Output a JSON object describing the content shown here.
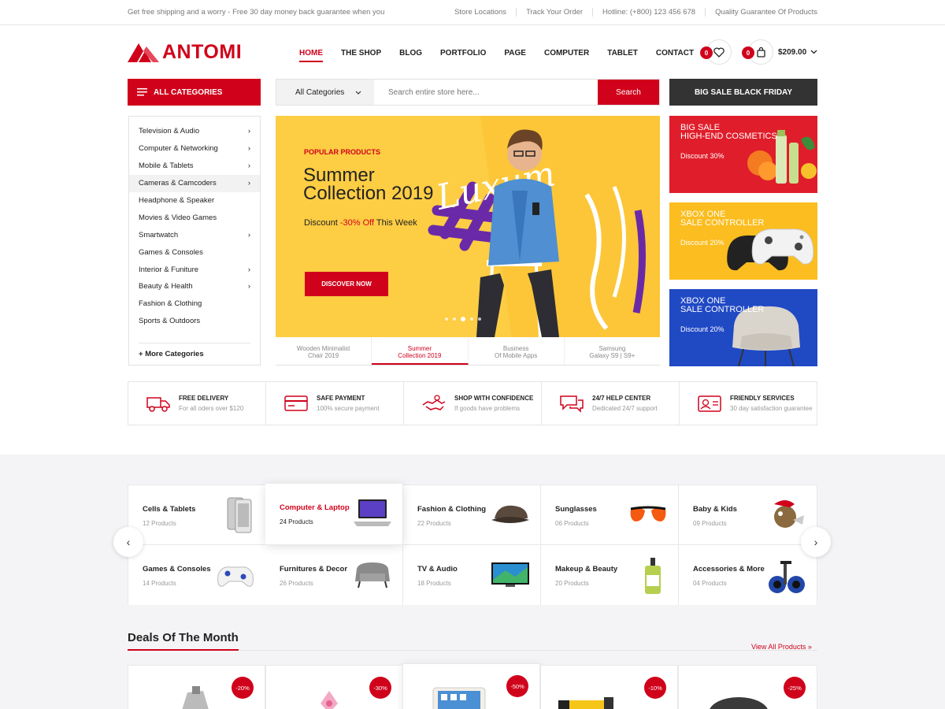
{
  "topbar": {
    "message": "Get free shipping and a worry - Free 30 day money back guarantee when you",
    "links": [
      "Store Locations",
      "Track Your Order",
      "Hotline: (+800) 123 456 678",
      "Quality Guarantee Of Products"
    ]
  },
  "brand": {
    "name": "ANTOMI",
    "color": "#d0021b"
  },
  "nav": {
    "items": [
      "HOME",
      "THE SHOP",
      "BLOG",
      "PORTFOLIO",
      "PAGE",
      "COMPUTER",
      "TABLET",
      "CONTACT"
    ],
    "active": "HOME"
  },
  "header": {
    "wishlist_count": "0",
    "cart_count": "0",
    "cart_total": "$209.00"
  },
  "categories_button": "ALL CATEGORIES",
  "search": {
    "category": "All Categories",
    "placeholder": "Search entire store here...",
    "button": "Search"
  },
  "big_sale": "BIG SALE BLACK FRIDAY",
  "category_list": [
    "Television & Audio",
    "Computer & Networking",
    "Mobile & Tablets",
    "Cameras & Camcoders",
    "Headphone & Speaker",
    "Movies & Video Games",
    "Smartwatch",
    "Games & Consoles",
    "Interior & Funiture",
    "Beauty & Health",
    "Fashion & Clothing",
    "Sports & Outdoors"
  ],
  "more_categories": "More Categories",
  "hero": {
    "eyebrow": "POPULAR PRODUCTS",
    "title_line1": "Summer",
    "title_line2": "Collection 2019",
    "discount_prefix": "Discount ",
    "discount_value": "-30% Off",
    "discount_suffix": " This Week",
    "button": "DISCOVER NOW",
    "script_text": "Luxum"
  },
  "slider_tabs": [
    {
      "line1": "Wooden Minimalist",
      "line2": "Chair 2019"
    },
    {
      "line1": "Summer",
      "line2": "Collection 2019"
    },
    {
      "line1": "Business",
      "line2": "Of Mobile Apps"
    },
    {
      "line1": "Samsung",
      "line2": "Galaxy S9 | S9+"
    }
  ],
  "promos": [
    {
      "line1": "BIG SALE",
      "line2": "HIGH-END COSMETICS",
      "discount": "Discount 30%",
      "color": "#e01e2b"
    },
    {
      "line1": "XBOX ONE",
      "line2": "SALE CONTROLLER",
      "discount": "Discount 20%",
      "color": "#fbbd1f"
    },
    {
      "line1": "XBOX ONE",
      "line2": "SALE CONTROLLER",
      "discount": "Discount 20%",
      "color": "#2049c4"
    }
  ],
  "features": [
    {
      "title": "FREE DELIVERY",
      "sub": "For all oders over $120"
    },
    {
      "title": "SAFE PAYMENT",
      "sub": "100% secure payment"
    },
    {
      "title": "SHOP WITH CONFIDENCE",
      "sub": "If goods have problems"
    },
    {
      "title": "24/7 HELP CENTER",
      "sub": "Dedicated 24/7 support"
    },
    {
      "title": "FRIENDLY SERVICES",
      "sub": "30 day satisfaction guarantee"
    }
  ],
  "cat_grid": [
    {
      "name": "Cells & Tablets",
      "count": "12 Products"
    },
    {
      "name": "Computer & Laptop",
      "count": "24 Products"
    },
    {
      "name": "Fashion & Clothing",
      "count": "22 Products"
    },
    {
      "name": "Sunglasses",
      "count": "06 Products"
    },
    {
      "name": "Baby & Kids",
      "count": "09 Products"
    },
    {
      "name": "Games & Consoles",
      "count": "14 Products"
    },
    {
      "name": "Furnitures & Decor",
      "count": "26 Products"
    },
    {
      "name": "TV & Audio",
      "count": "18 Products"
    },
    {
      "name": "Makeup & Beauty",
      "count": "20 Products"
    },
    {
      "name": "Accessories & More",
      "count": "04 Products"
    }
  ],
  "deals": {
    "title": "Deals Of The Month",
    "view_all": "View All Products"
  },
  "deal_badges": [
    "-20%",
    "-30%",
    "-50%",
    "-10%",
    "-25%"
  ]
}
